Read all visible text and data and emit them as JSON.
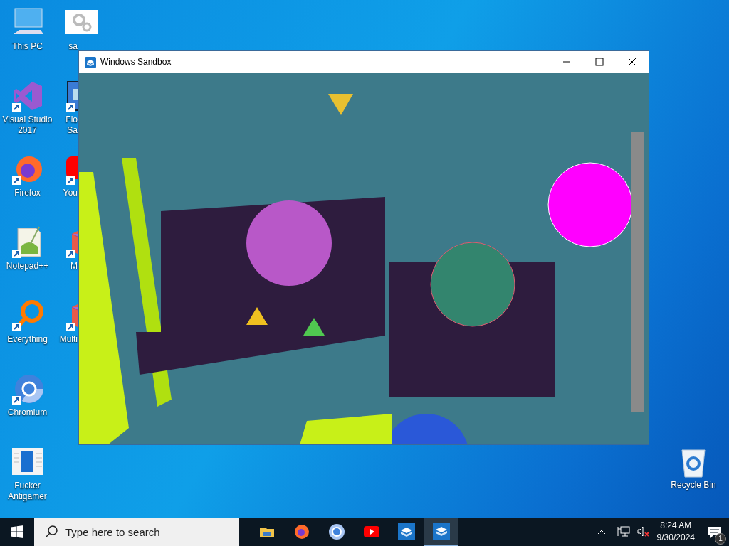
{
  "desktop_column_1": [
    {
      "kind": "computer",
      "label": "This PC"
    },
    {
      "kind": "vs",
      "label": "Visual Studio 2017"
    },
    {
      "kind": "firefox",
      "label": "Firefox"
    },
    {
      "kind": "notepad",
      "label": "Notepad++"
    },
    {
      "kind": "search",
      "label": "Everything"
    },
    {
      "kind": "chromium",
      "label": "Chromium"
    },
    {
      "kind": "document",
      "label": "Fucker Antigamer"
    }
  ],
  "desktop_column_2": [
    {
      "kind": "gears",
      "label": "sa"
    },
    {
      "kind": "printer",
      "label": "Flo Sa"
    },
    {
      "kind": "youtube",
      "label": "You"
    },
    {
      "kind": "box",
      "label": "M"
    },
    {
      "kind": "box",
      "label": "Multi"
    }
  ],
  "recycle_bin": {
    "label": "Recycle Bin"
  },
  "window": {
    "title": "Windows Sandbox"
  },
  "taskbar": {
    "search": {
      "placeholder": "Type here to search"
    },
    "apps": [
      {
        "kind": "folder",
        "selected": false
      },
      {
        "kind": "firefox",
        "selected": false
      },
      {
        "kind": "chromium",
        "selected": false
      },
      {
        "kind": "youtube",
        "selected": false
      },
      {
        "kind": "sandbox",
        "selected": false
      },
      {
        "kind": "sandbox",
        "selected": true
      }
    ],
    "time": "8:24 AM",
    "date": "9/30/2024",
    "notification_count": "1"
  }
}
